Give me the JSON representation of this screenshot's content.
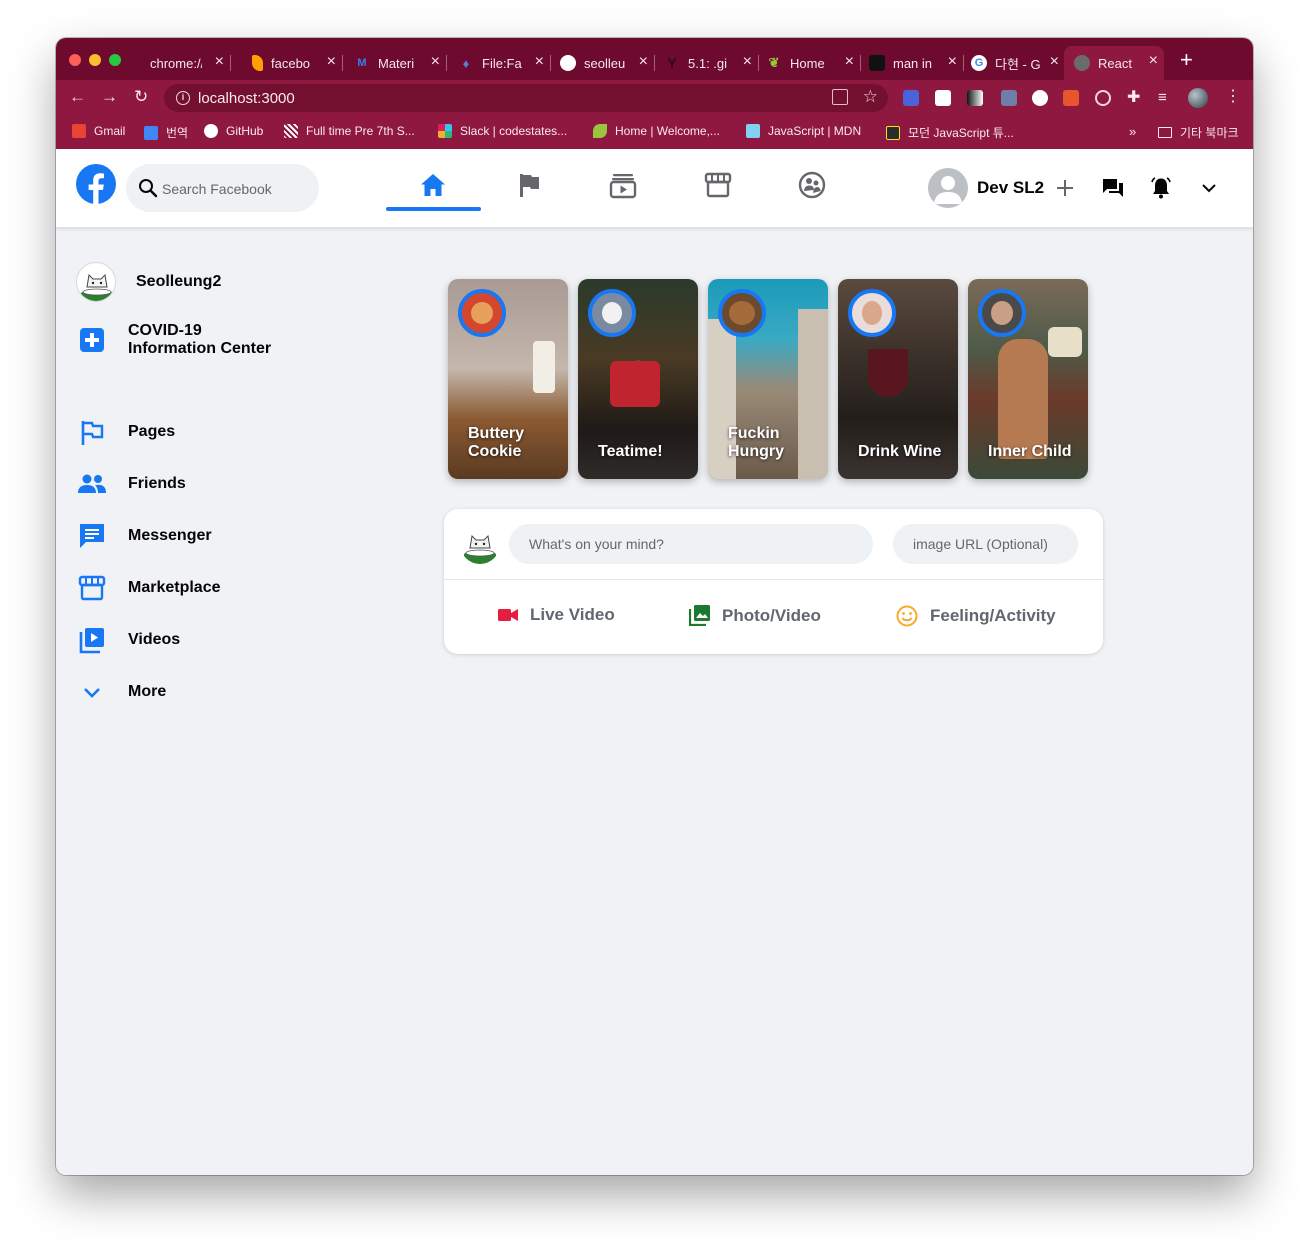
{
  "browser": {
    "tabs": [
      {
        "label": "chrome://n",
        "icon": "chrome-page-icon",
        "color": "#8a8a8a"
      },
      {
        "label": "facebo",
        "icon": "firebase-icon",
        "color": "#ffa000"
      },
      {
        "label": "Materi",
        "icon": "material-ui-icon",
        "color": "#3d7cf0"
      },
      {
        "label": "File:Fa",
        "icon": "fire-icon",
        "color": "#3b5998"
      },
      {
        "label": "seolleu",
        "icon": "github-icon",
        "color": "#ffffff"
      },
      {
        "label": "5.1: .gi",
        "icon": "git-icon",
        "color": "#222222"
      },
      {
        "label": "Home",
        "icon": "leaf-icon",
        "color": "#9bc53d"
      },
      {
        "label": "man in",
        "icon": "unsplash-icon",
        "color": "#111111"
      },
      {
        "label": "다현 - G",
        "icon": "google-icon",
        "color": "#ffffff"
      },
      {
        "label": "React",
        "icon": "react-icon",
        "color": "#61dafb"
      }
    ],
    "url": "localhost:3000",
    "bookmarks": [
      {
        "label": "Gmail",
        "color": "#ea4335"
      },
      {
        "label": "번역",
        "color": "#4285f4"
      },
      {
        "label": "GitHub",
        "color": "#ffffff"
      },
      {
        "label": "Full time Pre 7th S...",
        "color": "#cfcfcf"
      },
      {
        "label": "Slack | codestates...",
        "color": "#e01e5a"
      },
      {
        "label": "Home | Welcome,...",
        "color": "#9bc53d"
      },
      {
        "label": "JavaScript | MDN",
        "color": "#83d0f2"
      },
      {
        "label": "모던 JavaScript 튜...",
        "color": "#f7df1e"
      }
    ],
    "bookmarks_more": "»",
    "other_bookmarks": "기타 북마크",
    "new_tab": "+"
  },
  "header": {
    "search_placeholder": "Search Facebook",
    "user_name": "Dev SL2",
    "accent": "#1877f2"
  },
  "sidebar": {
    "profile_name": "Seolleung2",
    "items": [
      {
        "label": "COVID-19 Information Center",
        "line1": "COVID-19",
        "line2": "Information Center",
        "icon": "covid-plus-icon"
      },
      {
        "label": "Pages",
        "icon": "flag-icon"
      },
      {
        "label": "Friends",
        "icon": "people-icon"
      },
      {
        "label": "Messenger",
        "icon": "chat-icon"
      },
      {
        "label": "Marketplace",
        "icon": "storefront-icon"
      },
      {
        "label": "Videos",
        "icon": "video-library-icon"
      },
      {
        "label": "More",
        "icon": "chevron-down-icon"
      }
    ]
  },
  "stories": [
    {
      "title": "Buttery Cookie",
      "bg": "#b9a797"
    },
    {
      "title": "Teatime!",
      "bg": "#3a2f26"
    },
    {
      "title": "Fuckin Hungry",
      "bg": "#2c8fa6"
    },
    {
      "title": "Drink Wine",
      "bg": "#2d2724"
    },
    {
      "title": "Inner Child",
      "bg": "#5a4b3e"
    }
  ],
  "composer": {
    "post_placeholder": "What's on your mind?",
    "image_placeholder": "image URL (Optional)",
    "actions": [
      {
        "label": "Live Video",
        "color": "#e41e3f"
      },
      {
        "label": "Photo/Video",
        "color": "#1b7a2f"
      },
      {
        "label": "Feeling/Activity",
        "color": "#f7b928"
      }
    ]
  }
}
